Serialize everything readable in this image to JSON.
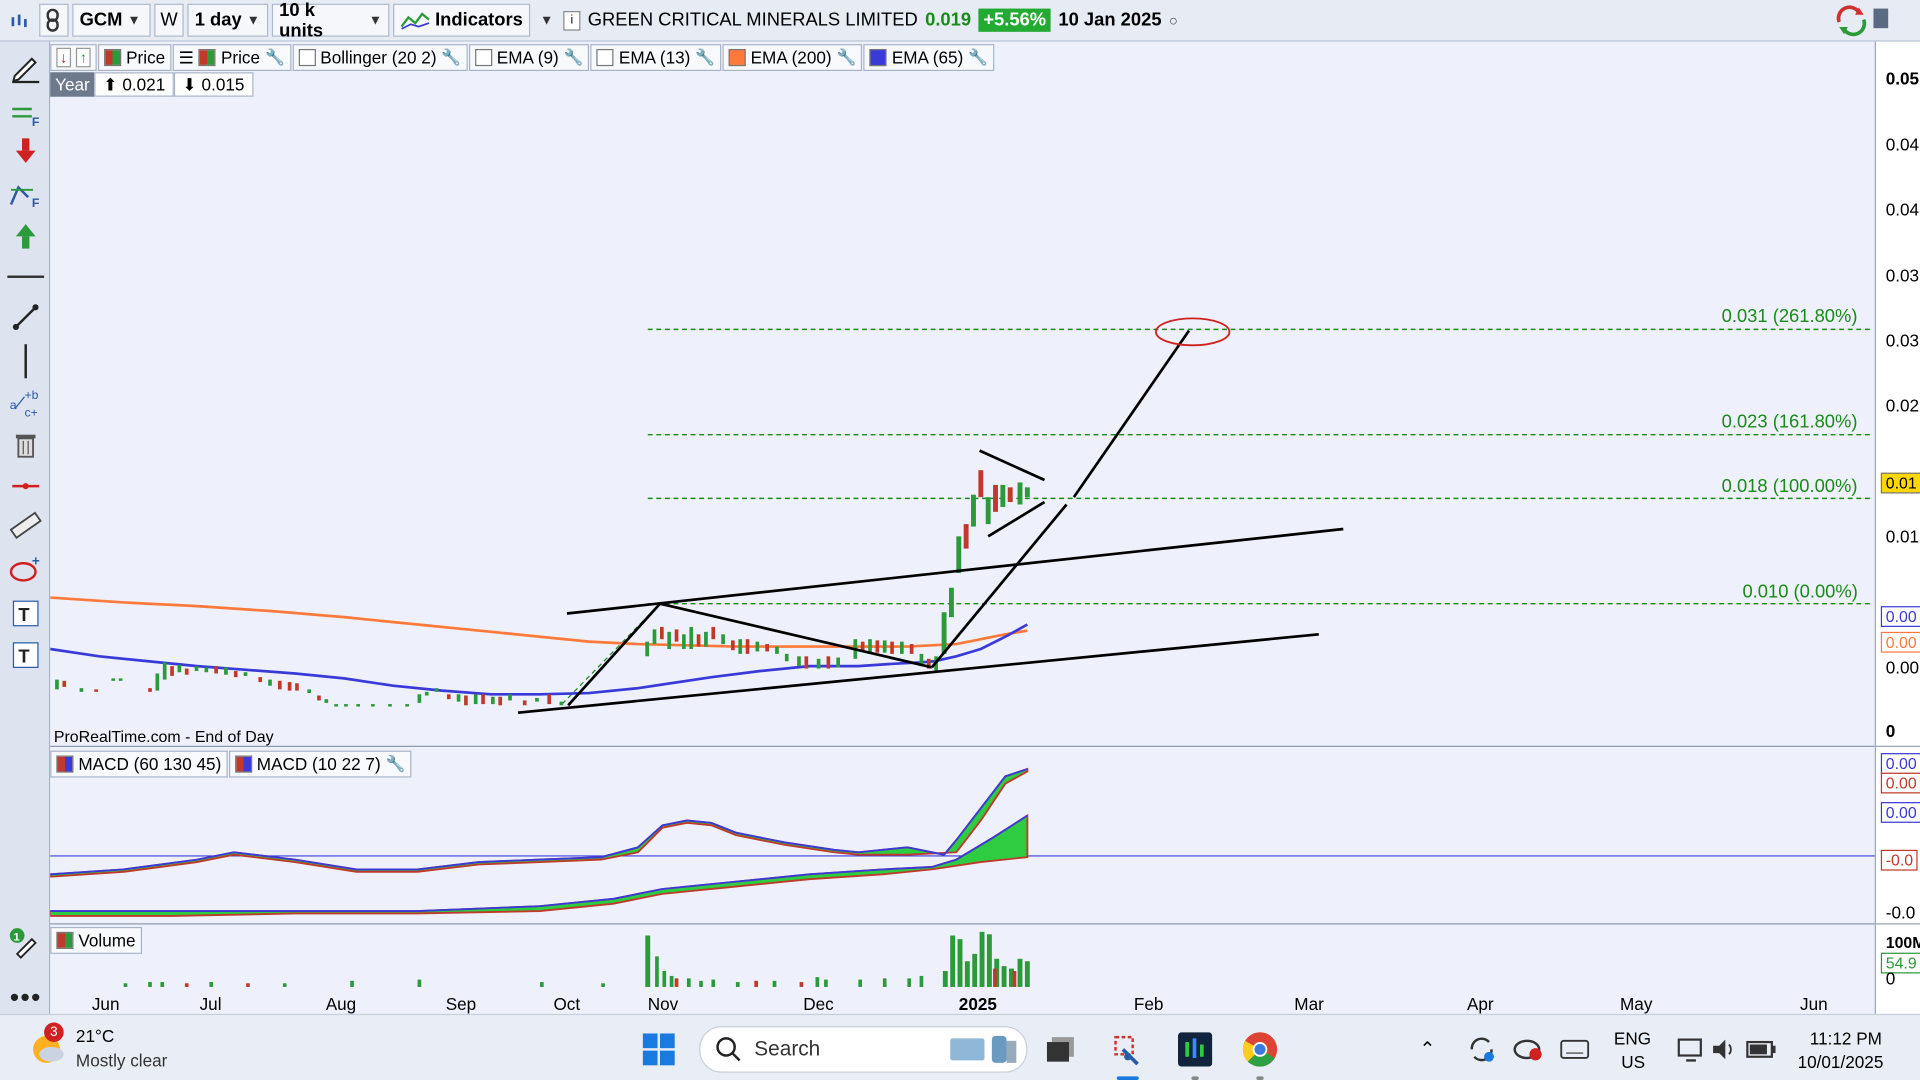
{
  "toolbar": {
    "symbol": "GCM",
    "period_btn": "W",
    "timeframe": "1 day",
    "units": "10 k units",
    "indicators": "Indicators",
    "company": "GREEN CRITICAL MINERALS LIMITED",
    "last_price": "0.019",
    "change": "+5.56%",
    "date": "10 Jan 2025"
  },
  "legend": {
    "items": [
      {
        "label": "Price",
        "color": "#2a9a3a"
      },
      {
        "label": "Price",
        "color": "#2a9a3a"
      },
      {
        "label": "Bollinger (20 2)",
        "color": "#ffffff"
      },
      {
        "label": "EMA (9)",
        "color": "#ffffff"
      },
      {
        "label": "EMA (13)",
        "color": "#ffffff"
      },
      {
        "label": "EMA (200)",
        "color": "#ff7a3a"
      },
      {
        "label": "EMA (65)",
        "color": "#3a3ad8"
      }
    ],
    "year_label": "Year",
    "year_high": "0.021",
    "year_low": "0.015"
  },
  "price_axis": {
    "labels": [
      "0.05",
      "0.04",
      "0.04",
      "0.03",
      "0.03",
      "0.02",
      "0.01",
      "0.00",
      "0"
    ],
    "current_tag": "0.01",
    "ema_tags": [
      "0.00",
      "0.00"
    ]
  },
  "fib_levels": [
    {
      "label": "0.031 (261.80%)"
    },
    {
      "label": "0.023 (161.80%)"
    },
    {
      "label": "0.018 (100.00%)"
    },
    {
      "label": "0.010 (0.00%)"
    }
  ],
  "source": "ProRealTime.com - End of Day",
  "macd": {
    "legend": [
      "MACD (60 130 45)",
      "MACD (10 22 7)"
    ],
    "axis": [
      "0.00",
      "0.00",
      "0.00",
      "-0.0",
      "-0.0"
    ]
  },
  "volume": {
    "legend": "Volume",
    "axis": [
      "100M",
      "54.9",
      "0"
    ]
  },
  "xaxis": [
    "Jun",
    "Jul",
    "Aug",
    "Sep",
    "Oct",
    "Nov",
    "Dec",
    "2025",
    "Feb",
    "Mar",
    "Apr",
    "May",
    "Jun"
  ],
  "taskbar": {
    "weather_badge": "3",
    "temperature": "21°C",
    "weather": "Mostly clear",
    "search": "Search",
    "lang1": "ENG",
    "lang2": "US",
    "time": "11:12 PM",
    "date": "10/01/2025"
  },
  "colors": {
    "ema200": "#ff7a3a",
    "ema65": "#3a3ad8",
    "up": "#2a9a3a",
    "down": "#c0392b",
    "fib": "#1a8a1a"
  }
}
